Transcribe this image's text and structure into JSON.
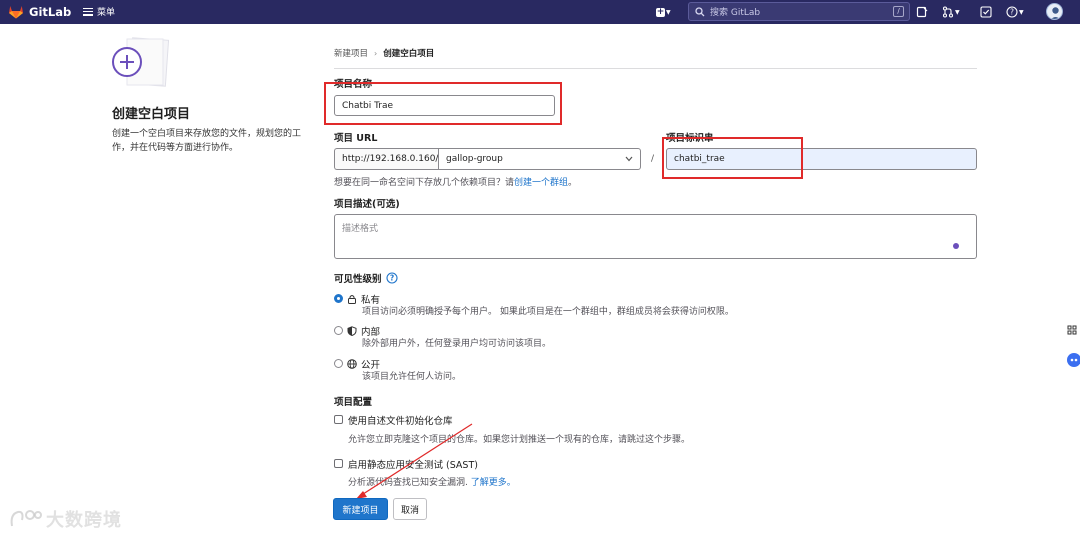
{
  "topbar": {
    "brand": "GitLab",
    "menu_label": "菜单",
    "search_placeholder": "搜索 GitLab",
    "search_shortcut": "/",
    "icons": [
      "gitlab-logo-icon",
      "plus-icon",
      "search-icon",
      "issues-icon",
      "merge-request-icon",
      "todo-icon",
      "help-icon",
      "avatar"
    ]
  },
  "left": {
    "title": "创建空白项目",
    "description": "创建一个空白项目来存放您的文件，规划您的工作，并在代码等方面进行协作。"
  },
  "breadcrumb": {
    "parent": "新建项目",
    "separator": "›",
    "current": "创建空白项目"
  },
  "form": {
    "project_name_label": "项目名称",
    "project_name_value": "Chatbi Trae",
    "project_url_label": "项目 URL",
    "url_prefix": "http://192.168.0.160/",
    "namespace_value": "gallop-group",
    "url_slash": "/",
    "slug_label": "项目标识串",
    "slug_value": "chatbi_trae",
    "group_help_text": "想要在同一命名空间下存放几个依赖项目？请",
    "group_help_link": "创建一个群组",
    "group_help_end": "。",
    "description_label": "项目描述(可选)",
    "description_placeholder": "描述格式",
    "visibility_label": "可见性级别",
    "visibility_options": [
      {
        "title": "私有",
        "desc": "项目访问必须明确授予每个用户。 如果此项目是在一个群组中，群组成员将会获得访问权限。",
        "checked": true
      },
      {
        "title": "内部",
        "desc": "除外部用户外，任何登录用户均可访问该项目。",
        "checked": false
      },
      {
        "title": "公开",
        "desc": "该项目允许任何人访问。",
        "checked": false
      }
    ],
    "config_label": "项目配置",
    "config_options": [
      {
        "title": "使用自述文件初始化仓库",
        "desc": "允许您立即克隆这个项目的仓库。如果您计划推送一个现有的仓库，请跳过这个步骤。",
        "link": ""
      },
      {
        "title": "启用静态应用安全测试 (SAST)",
        "desc": "分析源代码查找已知安全漏洞.",
        "link": "了解更多。"
      }
    ],
    "create_button": "新建项目",
    "cancel_button": "取消"
  },
  "watermark": "大数跨境",
  "colors": {
    "nav_bg": "#292961",
    "primary": "#1f75cb",
    "annotation": "#e02a2a"
  }
}
